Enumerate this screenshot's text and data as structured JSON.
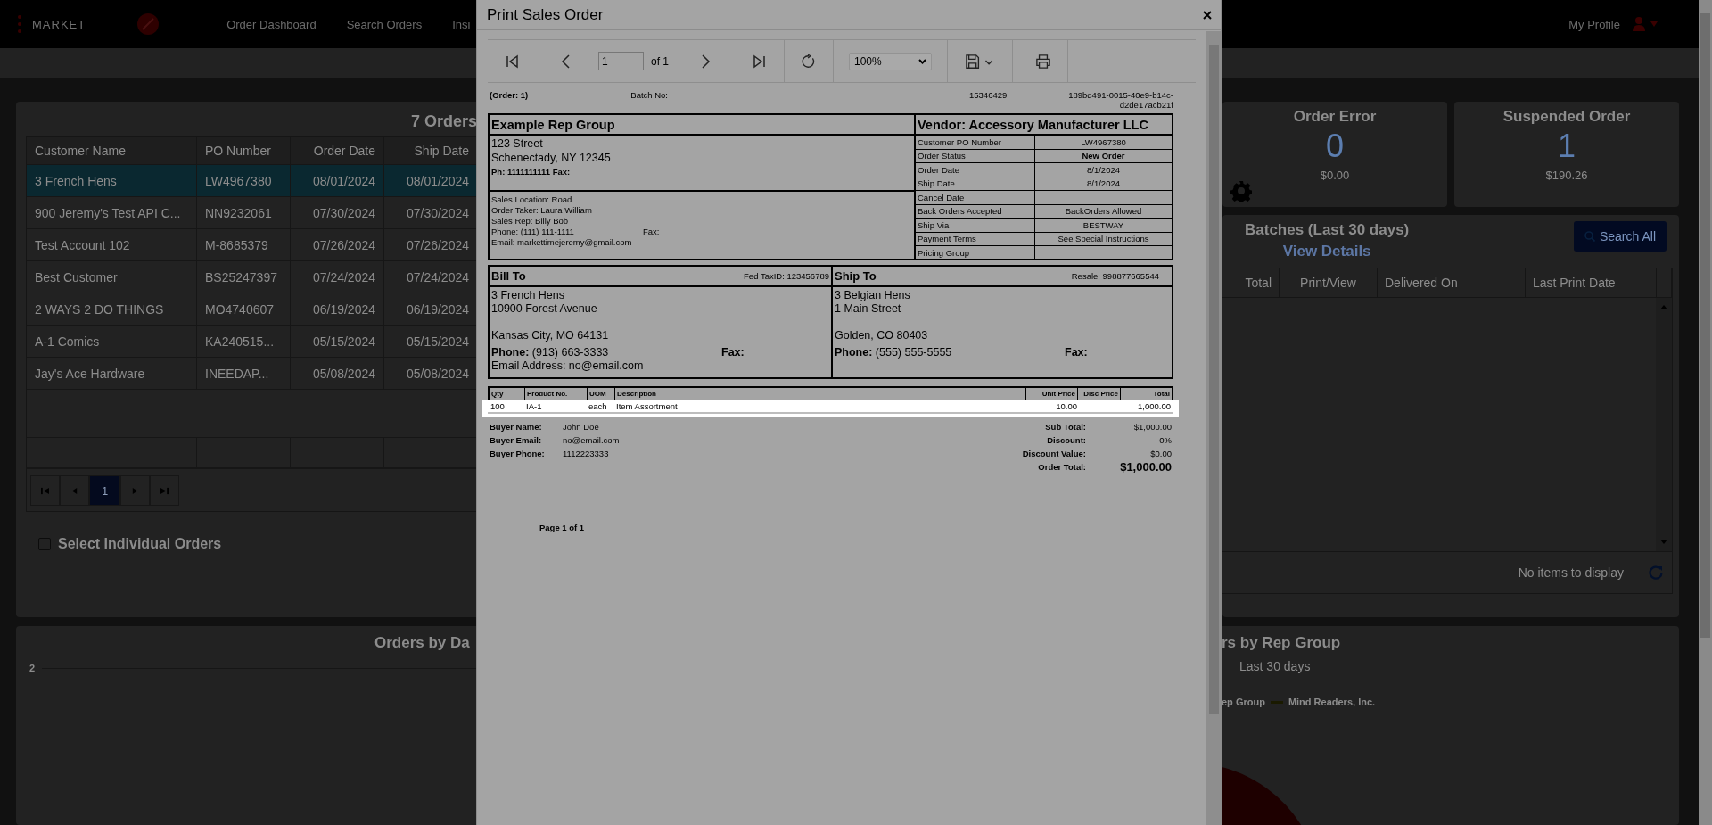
{
  "header": {
    "logo_text": "MARKET",
    "nav": [
      {
        "label": "Order Dashboard"
      },
      {
        "label": "Search Orders"
      },
      {
        "label": "Insi"
      }
    ],
    "profile": "My Profile"
  },
  "orders_panel": {
    "title": "7 Orders",
    "columns": [
      "Customer Name",
      "PO Number",
      "Order Date",
      "Ship Date"
    ],
    "rows": [
      {
        "cells": [
          "3 French Hens",
          "LW4967380",
          "08/01/2024",
          "08/01/2024"
        ],
        "selected": true
      },
      {
        "cells": [
          "900 Jeremy's Test API C...",
          "NN9232061",
          "07/30/2024",
          "07/30/2024"
        ],
        "selected": false
      },
      {
        "cells": [
          "Test Account 102",
          "M-8685379",
          "07/26/2024",
          "07/26/2024"
        ],
        "selected": false
      },
      {
        "cells": [
          "Best Customer",
          "BS25247397",
          "07/24/2024",
          "07/24/2024"
        ],
        "selected": false
      },
      {
        "cells": [
          "2 WAYS 2 DO THINGS",
          "MO4740607",
          "06/19/2024",
          "06/19/2024"
        ],
        "selected": false
      },
      {
        "cells": [
          "A-1 Comics",
          "KA240515...",
          "05/15/2024",
          "05/15/2024"
        ],
        "selected": false
      },
      {
        "cells": [
          "Jay's Ace Hardware",
          "INEEDAP...",
          "05/08/2024",
          "05/08/2024"
        ],
        "selected": false
      }
    ],
    "pager": {
      "pages": [
        {
          "label": "1",
          "selected": true
        }
      ]
    },
    "select_individual": {
      "label": "Select Individual Orders",
      "checked": false
    }
  },
  "stat_cards": [
    {
      "title": "Order Error",
      "count": "0",
      "amount": "$0.00",
      "settings": true
    },
    {
      "title": "Suspended Order",
      "count": "1",
      "amount": "$190.26",
      "settings": false
    }
  ],
  "batches": {
    "title": "Batches  (Last 30 days)",
    "link": "View Details",
    "search_button": "Search All",
    "columns": [
      "Total",
      "Print/View",
      "Delivered On",
      "Last Print Date"
    ],
    "empty_message": "No items to display"
  },
  "orders_by_date": {
    "title": "Orders by Da",
    "y_tick": "2"
  },
  "orders_by_rep": {
    "title": "rs by Rep Group",
    "subtitle": "Last 30 days",
    "legend": [
      {
        "label": "ep Group",
        "marker": false
      },
      {
        "label": "Mind Readers, Inc.",
        "marker": true
      }
    ]
  },
  "modal": {
    "title": "Print Sales Order",
    "toolbar": {
      "page": "1",
      "page_count": "of 1",
      "zoom": "100%"
    },
    "report": {
      "order_label": "(Order: 1)",
      "batch_label": "Batch No:",
      "batch_number": "15346429",
      "guid": "189bd491-0015-40e9-b14c-d2de17acb21f",
      "rep_group": {
        "name": "Example Rep Group",
        "address_lines": [
          "123 Street",
          "Schenectady, NY 12345"
        ],
        "phone_line": "Ph: 1111111111  Fax:",
        "details": [
          "Sales Location: Road",
          "Order Taker: Laura William",
          "Sales Rep: Billy Bob"
        ],
        "phone": "Phone: (111) 111-1111",
        "fax": "Fax:",
        "email": "Email: markettimejeremy@gmail.com"
      },
      "vendor": {
        "title": "Vendor: Accessory Manufacturer LLC",
        "fields": [
          {
            "label": "Customer PO Number",
            "value": "LW4967380",
            "emphasis": false
          },
          {
            "label": "Order Status",
            "value": "New Order",
            "emphasis": true
          },
          {
            "label": "Order Date",
            "value": "8/1/2024",
            "emphasis": false
          },
          {
            "label": "Ship Date",
            "value": "8/1/2024",
            "emphasis": false
          },
          {
            "label": "Cancel Date"
          },
          {
            "label": "Back Orders Accepted",
            "value": "BackOrders Allowed",
            "emphasis": false
          },
          {
            "label": "Ship Via",
            "value": "BESTWAY",
            "emphasis": false
          },
          {
            "label": "Payment Terms",
            "value": "See Special Instructions",
            "emphasis": false
          },
          {
            "label": "Pricing Group"
          }
        ]
      },
      "parties": [
        {
          "title": "Bill To",
          "tag": "Fed TaxID: 123456789",
          "address_lines": [
            "3 French Hens",
            "10900 Forest Avenue"
          ],
          "city_line": "Kansas City, MO 64131",
          "phone": "**Phone:** (913) 663-3333",
          "fax": "Fax:",
          "email": "Email Address: no@email.com"
        },
        {
          "title": "Ship To",
          "tag": "Resale: 998877665544",
          "address_lines": [
            "3 Belgian Hens",
            "1 Main Street"
          ],
          "city_line": "Golden, CO 80403",
          "phone": "**Phone:** (555) 555-5555",
          "fax": "Fax:"
        }
      ],
      "line_columns": [
        "Qty",
        "Product No.",
        "UOM",
        "Description",
        "Unit Price",
        "Disc Price",
        "Total"
      ],
      "lines": [
        {
          "qty": "100",
          "product_no": "IA-1",
          "uom": "each",
          "description": "Item Assortment",
          "unit_price": "10.00",
          "total": "1,000.00"
        }
      ],
      "buyer": [
        {
          "label": "Buyer Name:",
          "value": "John Doe"
        },
        {
          "label": "Buyer Email:",
          "value": "no@email.com"
        },
        {
          "label": "Buyer Phone:",
          "value": "1112223333"
        }
      ],
      "totals": [
        {
          "label": "Sub Total:",
          "value": "$1,000.00",
          "emphasis": false
        },
        {
          "label": "Discount:",
          "value": "0%",
          "emphasis": false
        },
        {
          "label": "Discount Value:",
          "value": "$0.00",
          "emphasis": false
        },
        {
          "label": "Order Total:",
          "value": "$1,000.00",
          "emphasis": true
        }
      ],
      "footer": "Page 1 of 1"
    }
  }
}
